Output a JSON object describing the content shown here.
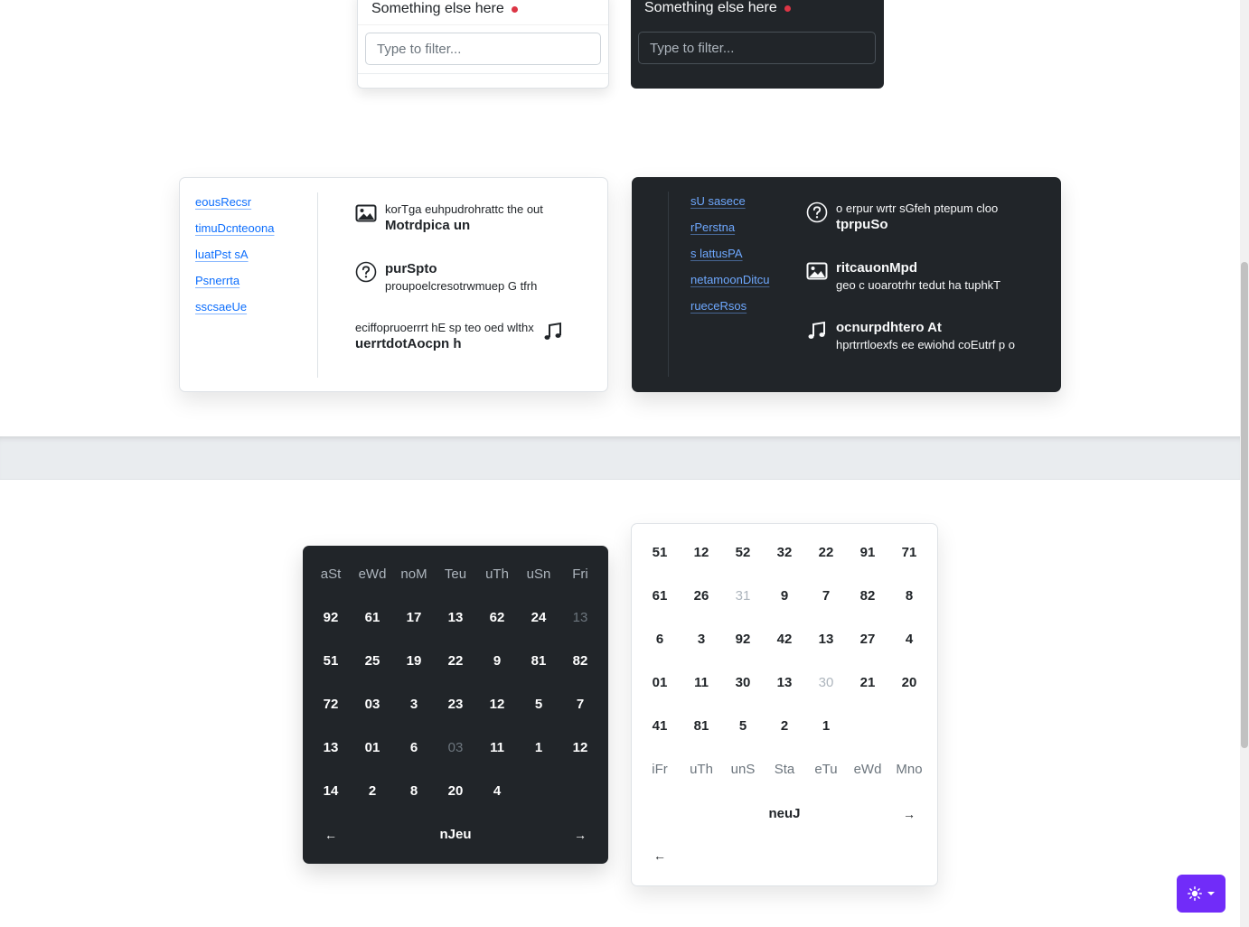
{
  "dropdowns": {
    "light": {
      "item": "Something else here",
      "filter_placeholder": "Type to filter..."
    },
    "dark": {
      "item": "Something else here",
      "filter_placeholder": "Type to filter..."
    }
  },
  "list_cards": {
    "light": {
      "links": [
        "eousRecsr",
        "timuDcnteoona",
        "luatPst sA",
        "Psnerrta",
        "sscsaeUe"
      ],
      "items": [
        {
          "icon": "image-icon",
          "subtitle": "korTga euhpudrohrattc the out",
          "title": "Motrdpica un"
        },
        {
          "icon": "question-circle-icon",
          "title": "purSpto",
          "subtitle": "proupoelcresotrwmuep G tfrh"
        },
        {
          "icon": "music-note-icon",
          "subtitle": "eciffopruoerrrt hE sp teo oed wlthx",
          "title": "uerrtdotAocpn h"
        }
      ]
    },
    "dark": {
      "links": [
        "sU sasece",
        "rPerstna",
        "s lattusPA",
        "netamoonDitcu",
        "rueceRsos"
      ],
      "items": [
        {
          "icon": "question-circle-icon",
          "subtitle": "o erpur wrtr sGfeh ptepum cloo",
          "title": "tprpuSo"
        },
        {
          "icon": "image-icon",
          "title": "ritcauonMpd",
          "subtitle": "geo c uoarotrhr tedut ha tuphkT"
        },
        {
          "icon": "music-note-icon",
          "title": "ocnurpdhtero At",
          "subtitle": "hprtrrtloexfs ee ewiohd coEutrf p o"
        }
      ]
    }
  },
  "calendars": {
    "dark": {
      "weekdays": [
        "aSt",
        "eWd",
        "noM",
        "Teu",
        "uTh",
        "uSn",
        "Fri"
      ],
      "rows": [
        [
          "92",
          "61",
          "17",
          "13",
          "62",
          "24",
          "13"
        ],
        [
          "51",
          "25",
          "19",
          "22",
          "9",
          "81",
          "82"
        ],
        [
          "72",
          "03",
          "3",
          "23",
          "12",
          "5",
          "7"
        ],
        [
          "13",
          "01",
          "6",
          "03",
          "11",
          "1",
          "12"
        ],
        [
          "14",
          "2",
          "8",
          "20",
          "4",
          "",
          ""
        ]
      ],
      "muted": [
        [
          0,
          6
        ],
        [
          3,
          3
        ]
      ],
      "prev": "←",
      "next": "→",
      "month": "nJeu"
    },
    "light": {
      "rows": [
        [
          "51",
          "12",
          "52",
          "32",
          "22",
          "91",
          "71"
        ],
        [
          "61",
          "26",
          "31",
          "9",
          "7",
          "82",
          "8"
        ],
        [
          "6",
          "3",
          "92",
          "42",
          "13",
          "27",
          "4"
        ],
        [
          "01",
          "11",
          "30",
          "13",
          "30",
          "21",
          "20"
        ],
        [
          "41",
          "81",
          "5",
          "2",
          "1",
          "",
          ""
        ]
      ],
      "muted": [
        [
          1,
          2
        ],
        [
          3,
          4
        ]
      ],
      "weekdays": [
        "iFr",
        "uTh",
        "unS",
        "Sta",
        "eTu",
        "eWd",
        "Mno"
      ],
      "month": "neuJ",
      "next": "→",
      "prev": "←"
    }
  },
  "theme_toggle": {
    "icon": "sun-icon"
  },
  "colors": {
    "accent": "#712cf9",
    "link": "#0d6efd",
    "dark_bg": "#212529",
    "dot": "#dc3545"
  }
}
